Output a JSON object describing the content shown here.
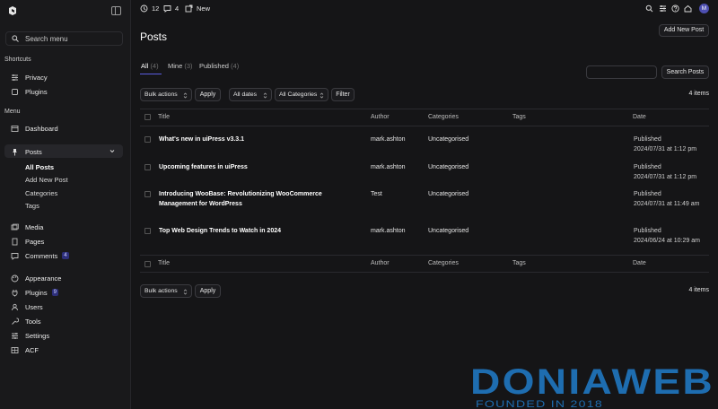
{
  "sidebar": {
    "search_placeholder": "Search menu",
    "shortcuts_heading": "Shortcuts",
    "shortcuts": [
      {
        "label": "Privacy"
      },
      {
        "label": "Plugins"
      }
    ],
    "menu_heading": "Menu",
    "dashboard": "Dashboard",
    "posts": "Posts",
    "posts_sub": [
      {
        "label": "All Posts"
      },
      {
        "label": "Add New Post"
      },
      {
        "label": "Categories"
      },
      {
        "label": "Tags"
      }
    ],
    "media": "Media",
    "pages": "Pages",
    "comments": "Comments",
    "comments_badge": "4",
    "appearance": "Appearance",
    "plugins": "Plugins",
    "plugins_badge": "9",
    "users": "Users",
    "tools": "Tools",
    "settings": "Settings",
    "acf": "ACF"
  },
  "topbar": {
    "updates": "12",
    "comments": "4",
    "new_label": "New",
    "avatar_initial": "M"
  },
  "main": {
    "title": "Posts",
    "add_new": "Add New Post",
    "views": [
      {
        "label": "All",
        "count": "(4)"
      },
      {
        "label": "Mine",
        "count": "(3)"
      },
      {
        "label": "Published",
        "count": "(4)"
      }
    ],
    "search_button": "Search Posts",
    "bulk_actions": "Bulk actions",
    "apply": "Apply",
    "all_dates": "All dates",
    "all_categories": "All Categories",
    "filter": "Filter",
    "items_count": "4 items",
    "columns": {
      "title": "Title",
      "author": "Author",
      "categories": "Categories",
      "tags": "Tags",
      "date": "Date"
    },
    "rows": [
      {
        "title": "What's new in uiPress v3.3.1",
        "author": "mark.ashton",
        "category": "Uncategorised",
        "tags": "",
        "status": "Published",
        "date": "2024/07/31 at 1:12 pm"
      },
      {
        "title": "Upcoming features in uiPress",
        "author": "mark.ashton",
        "category": "Uncategorised",
        "tags": "",
        "status": "Published",
        "date": "2024/07/31 at 1:12 pm"
      },
      {
        "title": "Introducing WooBase: Revolutionizing WooCommerce",
        "title2": "Management for WordPress",
        "author": "Test",
        "category": "Uncategorised",
        "tags": "",
        "status": "Published",
        "date": "2024/07/31 at 11:49 am"
      },
      {
        "title": "Top Web Design Trends to Watch in 2024",
        "author": "mark.ashton",
        "category": "Uncategorised",
        "tags": "",
        "status": "Published",
        "date": "2024/06/24 at 10:29 am"
      }
    ]
  },
  "watermark": {
    "brand": "DONIAWEB",
    "tagline": "FOUNDED IN 2018"
  },
  "colors": {
    "accent": "#5a5ce0",
    "watermark": "#1e6db0"
  }
}
